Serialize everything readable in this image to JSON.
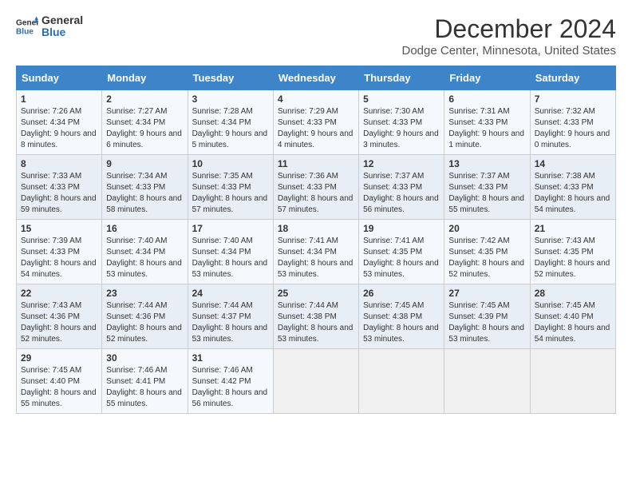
{
  "header": {
    "logo_line1": "General",
    "logo_line2": "Blue",
    "title": "December 2024",
    "subtitle": "Dodge Center, Minnesota, United States"
  },
  "columns": [
    "Sunday",
    "Monday",
    "Tuesday",
    "Wednesday",
    "Thursday",
    "Friday",
    "Saturday"
  ],
  "weeks": [
    [
      {
        "day": "1",
        "sunrise": "7:26 AM",
        "sunset": "4:34 PM",
        "daylight": "9 hours and 8 minutes."
      },
      {
        "day": "2",
        "sunrise": "7:27 AM",
        "sunset": "4:34 PM",
        "daylight": "9 hours and 6 minutes."
      },
      {
        "day": "3",
        "sunrise": "7:28 AM",
        "sunset": "4:34 PM",
        "daylight": "9 hours and 5 minutes."
      },
      {
        "day": "4",
        "sunrise": "7:29 AM",
        "sunset": "4:33 PM",
        "daylight": "9 hours and 4 minutes."
      },
      {
        "day": "5",
        "sunrise": "7:30 AM",
        "sunset": "4:33 PM",
        "daylight": "9 hours and 3 minutes."
      },
      {
        "day": "6",
        "sunrise": "7:31 AM",
        "sunset": "4:33 PM",
        "daylight": "9 hours and 1 minute."
      },
      {
        "day": "7",
        "sunrise": "7:32 AM",
        "sunset": "4:33 PM",
        "daylight": "9 hours and 0 minutes."
      }
    ],
    [
      {
        "day": "8",
        "sunrise": "7:33 AM",
        "sunset": "4:33 PM",
        "daylight": "8 hours and 59 minutes."
      },
      {
        "day": "9",
        "sunrise": "7:34 AM",
        "sunset": "4:33 PM",
        "daylight": "8 hours and 58 minutes."
      },
      {
        "day": "10",
        "sunrise": "7:35 AM",
        "sunset": "4:33 PM",
        "daylight": "8 hours and 57 minutes."
      },
      {
        "day": "11",
        "sunrise": "7:36 AM",
        "sunset": "4:33 PM",
        "daylight": "8 hours and 57 minutes."
      },
      {
        "day": "12",
        "sunrise": "7:37 AM",
        "sunset": "4:33 PM",
        "daylight": "8 hours and 56 minutes."
      },
      {
        "day": "13",
        "sunrise": "7:37 AM",
        "sunset": "4:33 PM",
        "daylight": "8 hours and 55 minutes."
      },
      {
        "day": "14",
        "sunrise": "7:38 AM",
        "sunset": "4:33 PM",
        "daylight": "8 hours and 54 minutes."
      }
    ],
    [
      {
        "day": "15",
        "sunrise": "7:39 AM",
        "sunset": "4:33 PM",
        "daylight": "8 hours and 54 minutes."
      },
      {
        "day": "16",
        "sunrise": "7:40 AM",
        "sunset": "4:34 PM",
        "daylight": "8 hours and 53 minutes."
      },
      {
        "day": "17",
        "sunrise": "7:40 AM",
        "sunset": "4:34 PM",
        "daylight": "8 hours and 53 minutes."
      },
      {
        "day": "18",
        "sunrise": "7:41 AM",
        "sunset": "4:34 PM",
        "daylight": "8 hours and 53 minutes."
      },
      {
        "day": "19",
        "sunrise": "7:41 AM",
        "sunset": "4:35 PM",
        "daylight": "8 hours and 53 minutes."
      },
      {
        "day": "20",
        "sunrise": "7:42 AM",
        "sunset": "4:35 PM",
        "daylight": "8 hours and 52 minutes."
      },
      {
        "day": "21",
        "sunrise": "7:43 AM",
        "sunset": "4:35 PM",
        "daylight": "8 hours and 52 minutes."
      }
    ],
    [
      {
        "day": "22",
        "sunrise": "7:43 AM",
        "sunset": "4:36 PM",
        "daylight": "8 hours and 52 minutes."
      },
      {
        "day": "23",
        "sunrise": "7:44 AM",
        "sunset": "4:36 PM",
        "daylight": "8 hours and 52 minutes."
      },
      {
        "day": "24",
        "sunrise": "7:44 AM",
        "sunset": "4:37 PM",
        "daylight": "8 hours and 53 minutes."
      },
      {
        "day": "25",
        "sunrise": "7:44 AM",
        "sunset": "4:38 PM",
        "daylight": "8 hours and 53 minutes."
      },
      {
        "day": "26",
        "sunrise": "7:45 AM",
        "sunset": "4:38 PM",
        "daylight": "8 hours and 53 minutes."
      },
      {
        "day": "27",
        "sunrise": "7:45 AM",
        "sunset": "4:39 PM",
        "daylight": "8 hours and 53 minutes."
      },
      {
        "day": "28",
        "sunrise": "7:45 AM",
        "sunset": "4:40 PM",
        "daylight": "8 hours and 54 minutes."
      }
    ],
    [
      {
        "day": "29",
        "sunrise": "7:45 AM",
        "sunset": "4:40 PM",
        "daylight": "8 hours and 55 minutes."
      },
      {
        "day": "30",
        "sunrise": "7:46 AM",
        "sunset": "4:41 PM",
        "daylight": "8 hours and 55 minutes."
      },
      {
        "day": "31",
        "sunrise": "7:46 AM",
        "sunset": "4:42 PM",
        "daylight": "8 hours and 56 minutes."
      },
      null,
      null,
      null,
      null
    ]
  ],
  "labels": {
    "sunrise": "Sunrise:",
    "sunset": "Sunset:",
    "daylight": "Daylight:"
  },
  "colors": {
    "header_bg": "#3d85c8",
    "accent": "#2a6db5"
  }
}
